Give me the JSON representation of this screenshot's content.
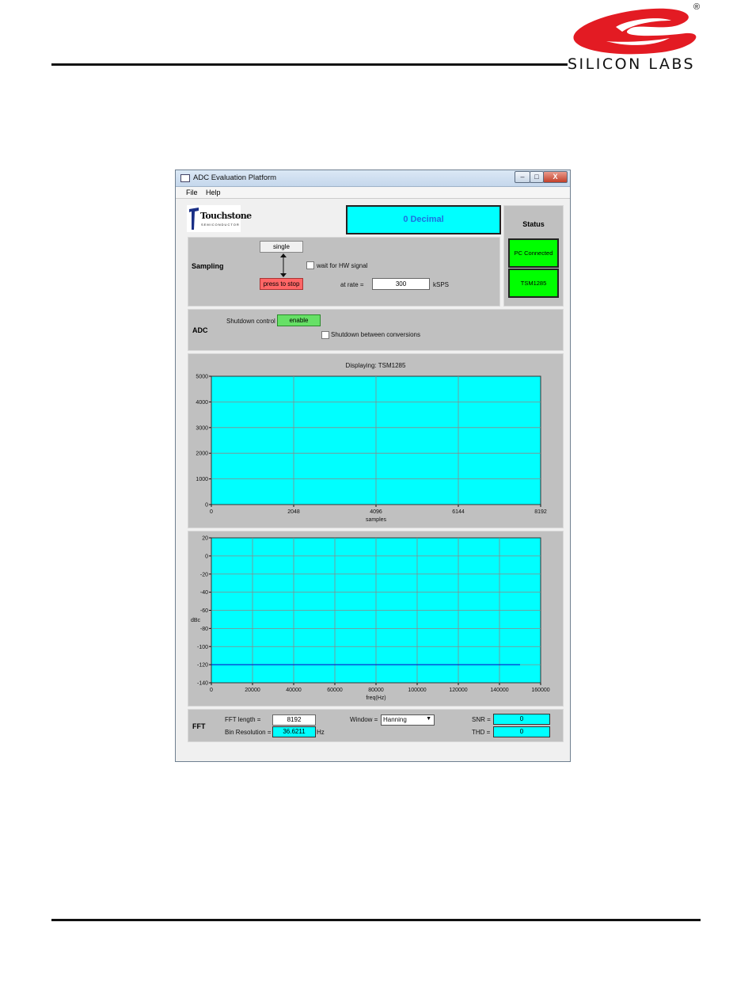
{
  "brand": {
    "logo_text": "SILICON LABS",
    "reg_mark": "®"
  },
  "window": {
    "title": "ADC Evaluation Platform",
    "controls": [
      "–",
      "□",
      "X"
    ]
  },
  "menu": [
    "File",
    "Help"
  ],
  "header": {
    "logo_text": "Touchstone",
    "logo_sub": "SEMICONDUCTOR",
    "decimal_display": "0 Decimal"
  },
  "status": {
    "title": "Status",
    "connection": "PC Connected",
    "device": "TSM1285"
  },
  "sampling": {
    "title": "Sampling",
    "single_button": "single",
    "stop_button": "press to stop",
    "wait_label": "wait for HW signal",
    "rate_label": "at rate =",
    "rate_value": "300",
    "rate_unit": "kSPS"
  },
  "adc": {
    "title": "ADC",
    "shutdown_label": "Shutdown control",
    "enable_button": "enable",
    "shutdown_between_label": "Shutdown between conversions"
  },
  "chart_data": [
    {
      "type": "line",
      "title": "Displaying: TSM1285",
      "xlabel": "samples",
      "ylabel": "",
      "xlim": [
        0,
        8192
      ],
      "ylim": [
        0,
        5000
      ],
      "x_ticks": [
        "0",
        "2048",
        "4096",
        "6144",
        "8192"
      ],
      "y_ticks": [
        "5000",
        "4000",
        "3000",
        "2000",
        "1000",
        "0"
      ],
      "grid": true,
      "background": "#00ffff",
      "series": []
    },
    {
      "type": "line",
      "title": "",
      "xlabel": "freq(Hz)",
      "ylabel": "dBc",
      "xlim": [
        0,
        160000
      ],
      "ylim": [
        -140,
        20
      ],
      "x_ticks": [
        "0",
        "20000",
        "40000",
        "60000",
        "80000",
        "100000",
        "120000",
        "140000",
        "160000"
      ],
      "y_ticks": [
        "20",
        "0",
        "-20",
        "-40",
        "-60",
        "-80",
        "-100",
        "-120",
        "-140"
      ],
      "grid": true,
      "background": "#00ffff",
      "series": [
        {
          "color": "#0000cc",
          "x": [
            0,
            150000
          ],
          "y": [
            -120,
            -120
          ]
        }
      ]
    }
  ],
  "fft": {
    "title": "FFT",
    "length_label": "FFT length =",
    "length_value": "8192",
    "binres_label": "Bin Resolution =",
    "binres_value": "36.6211",
    "binres_unit": "Hz",
    "window_label": "Window =",
    "window_value": "Hanning",
    "snr_label": "SNR =",
    "snr_value": "0",
    "thd_label": "THD =",
    "thd_value": "0"
  },
  "colors": {
    "panel": "#c0c0c0",
    "cyan": "#00ffff",
    "green": "#00ff00",
    "stop": "#ff6666",
    "brand_red": "#e31b23"
  }
}
